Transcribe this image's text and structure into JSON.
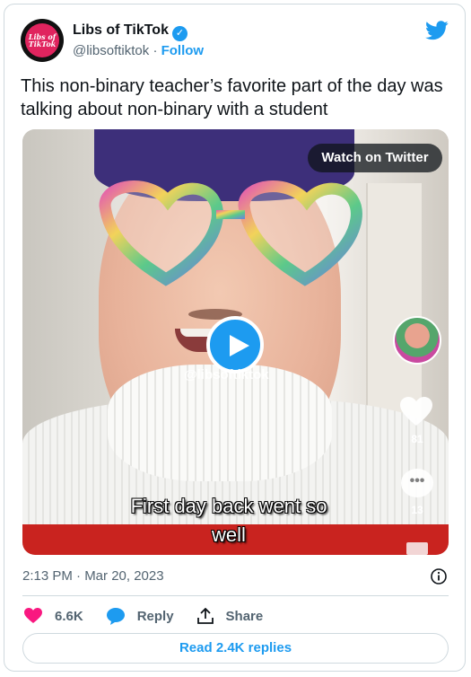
{
  "author": {
    "display_name": "Libs of TikTok",
    "handle": "@libsoftiktok",
    "separator": "·",
    "follow_label": "Follow",
    "avatar_text": "Libs of TikTok",
    "verified": true
  },
  "tweet": {
    "text": "This non-binary teacher’s favorite part of the day was talking about non-binary with a student",
    "timestamp": "2:13 PM · Mar 20, 2023"
  },
  "media": {
    "watch_label": "Watch on Twitter",
    "watermark": "@libsoftiktok",
    "like_count": "81",
    "comment_count": "13",
    "caption_line1": "First day back went so",
    "caption_line2": "well"
  },
  "actions": {
    "likes": "6.6K",
    "reply_label": "Reply",
    "share_label": "Share",
    "read_replies_label": "Read 2.4K replies"
  },
  "colors": {
    "twitter_blue": "#1d9bf0",
    "like_pink": "#f91880",
    "text_dark": "#0f1419",
    "text_gray": "#536471"
  },
  "icons": [
    "twitter-bird-icon",
    "verified-badge-icon",
    "play-icon",
    "info-icon",
    "heart-icon",
    "reply-bubble-icon",
    "share-icon"
  ]
}
